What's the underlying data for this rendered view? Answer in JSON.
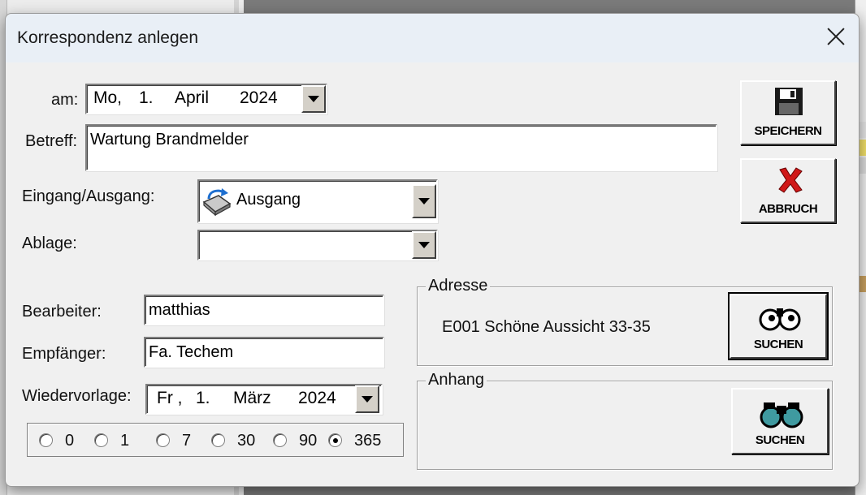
{
  "dialog": {
    "title": "Korrespondenz anlegen"
  },
  "form": {
    "am_label": "am:",
    "am_date": {
      "weekday": "Mo,",
      "day": "1.",
      "month": "April",
      "year": "2024"
    },
    "betreff_label": "Betreff:",
    "betreff_value": "Wartung Brandmelder",
    "eingang_label": "Eingang/Ausgang:",
    "eingang_value": "Ausgang",
    "ablage_label": "Ablage:",
    "ablage_value": "",
    "bearbeiter_label": "Bearbeiter:",
    "bearbeiter_value": "matthias",
    "empfaenger_label": "Empfänger:",
    "empfaenger_value": "Fa. Techem",
    "wiedervorlage_label": "Wiedervorlage:",
    "wv_date": {
      "weekday": "Fr ,",
      "day": "1.",
      "month": "März",
      "year": "2024"
    }
  },
  "radio_days": [
    {
      "label": "0",
      "checked": false
    },
    {
      "label": "1",
      "checked": false
    },
    {
      "label": "7",
      "checked": false
    },
    {
      "label": "30",
      "checked": false
    },
    {
      "label": "90",
      "checked": false
    },
    {
      "label": "365",
      "checked": true
    }
  ],
  "buttons": {
    "save": "SPEICHERN",
    "cancel": "ABBRUCH",
    "search_address": "SUCHEN",
    "search_attachment": "SUCHEN"
  },
  "adresse": {
    "title": "Adresse",
    "value": "E001 Schöne Aussicht 33-35"
  },
  "anhang": {
    "title": "Anhang"
  },
  "icons": {
    "save": "floppy-disk-icon",
    "cancel": "red-x-icon",
    "direction": "outgoing-mail-icon",
    "search": "binoculars-icon"
  }
}
